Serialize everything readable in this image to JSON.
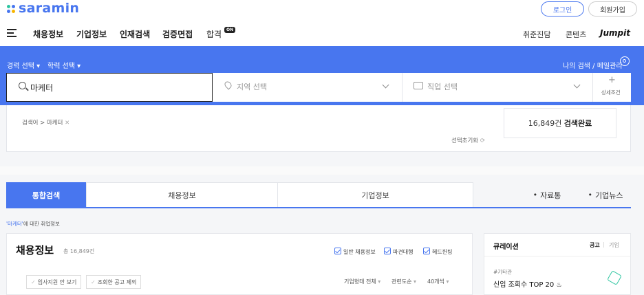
{
  "header": {
    "logo": "saramin",
    "login_label": "로그인",
    "signup_label": "회원가입",
    "nav": [
      "채용정보",
      "기업정보",
      "인재검색",
      "검증면접",
      "합격"
    ],
    "nav_badge": "ON",
    "nav_right": [
      "취준진담",
      "콘텐츠"
    ],
    "jumpit": "Jumpit"
  },
  "search": {
    "career_select": "경력 선택",
    "edu_select": "학력 선택",
    "my_search": "나의 검색 / 메일관리",
    "keyword": "마케터",
    "region_placeholder": "지역 선택",
    "job_placeholder": "직업 선택",
    "detail_label": "상세조건"
  },
  "filter": {
    "tag": "검색어 > 마케터",
    "result_count": "16,849건",
    "result_suffix": "검색완료",
    "reset": "선택초기화"
  },
  "tabs": {
    "integrated": "통합검색",
    "recruit": "채용정보",
    "company": "기업정보",
    "data_room": "자료통",
    "company_news": "기업뉴스"
  },
  "related_label_keyword": "'마케터'",
  "related_label_rest": "에 대한 취업정보",
  "recruit_card": {
    "title": "채용정보",
    "total": "총 16,849건",
    "checks": [
      "일반 채용정보",
      "파견대행",
      "헤드헌팅"
    ],
    "filter1": "입사지원 안 보기",
    "filter2": "조회한 공고 제외",
    "sort": [
      "기업형태 전체",
      "관련도순",
      "40개씩"
    ]
  },
  "curation": {
    "title": "큐레이션",
    "tab1": "공고",
    "tab2": "기업",
    "tag": "#기타관",
    "item": "신입 조회수 TOP 20"
  },
  "colors": {
    "brand": "#4876ef",
    "band": "#4876ef"
  }
}
